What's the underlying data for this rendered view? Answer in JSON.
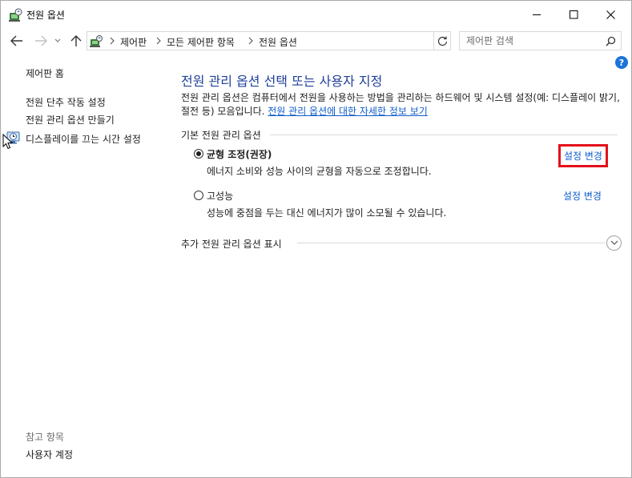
{
  "window": {
    "title": "전원 옵션",
    "min_glyph": "—",
    "max_glyph": "☐",
    "close_glyph": "✕"
  },
  "address": {
    "crumbs": [
      "제어판",
      "모든 제어판 항목",
      "전원 옵션"
    ]
  },
  "search": {
    "placeholder": "제어판 검색"
  },
  "leftpane": {
    "home": "제어판 홈",
    "power_button": "전원 단추 작동 설정",
    "create_plan": "전원 관리 옵션 만들기",
    "display_off": "디스플레이를 끄는 시간 설정",
    "see_also": "참고 항목",
    "user_accounts": "사용자 계정"
  },
  "help": {
    "label": "?"
  },
  "main": {
    "heading": "전원 관리 옵션 선택 또는 사용자 지정",
    "desc_text": "전원 관리 옵션은 컴퓨터에서 전원을 사용하는 방법을 관리하는 하드웨어 및 시스템 설정(예: 디스플레이 밝기, 절전 등) 모음입니다. ",
    "desc_link": "전원 관리 옵션에 대한 자세한 정보 보기",
    "section_title": "기본 전원 관리 옵션",
    "plans": [
      {
        "name": "균형 조정(권장)",
        "desc": "에너지 소비와 성능 사이의 균형을 자동으로 조정합니다.",
        "change": "설정 변경",
        "selected": true
      },
      {
        "name": "고성능",
        "desc": "성능에 중점을 두는 대신 에너지가 많이 소모될 수 있습니다.",
        "change": "설정 변경",
        "selected": false
      }
    ],
    "more_title": "추가 전원 관리 옵션 표시"
  },
  "colors": {
    "heading": "#1e3f9b",
    "link": "#0f5ccc",
    "highlight": "#e3101a",
    "help": "#1a73d9"
  }
}
